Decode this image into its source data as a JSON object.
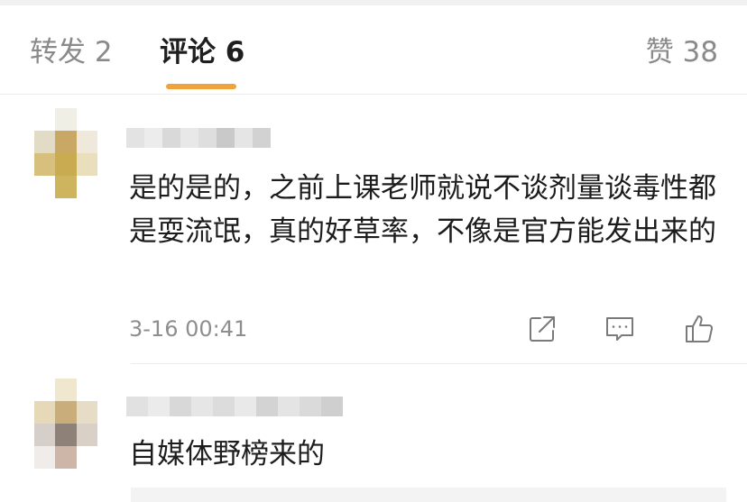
{
  "tabs": {
    "repost": "转发 2",
    "comments": "评论 6",
    "likes": "赞 38"
  },
  "accent_color": "#f0a23b",
  "comments": [
    {
      "text": "是的是的，之前上课老师就说不谈剂量谈毒性都是耍流氓，真的好草率，不像是官方能发出来的",
      "time": "3-16 00:41"
    },
    {
      "text": "自媒体野榜来的"
    }
  ],
  "icons": [
    "share-icon",
    "reply-icon",
    "like-icon"
  ]
}
